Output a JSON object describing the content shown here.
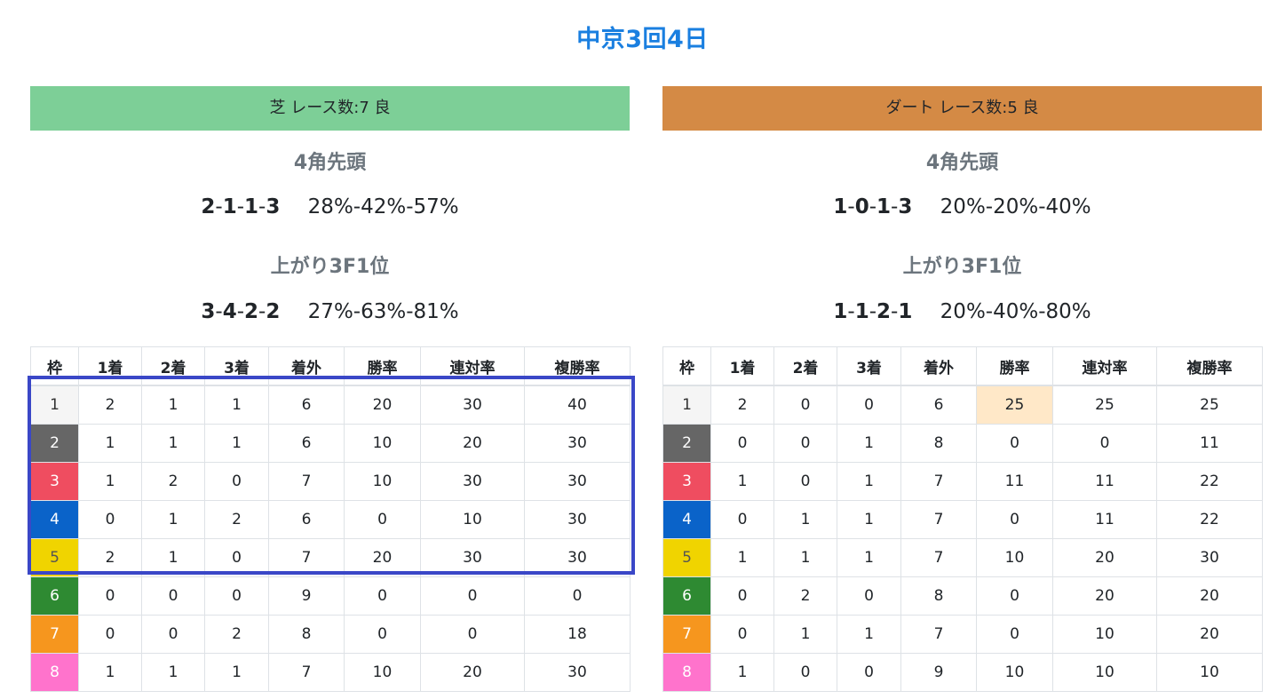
{
  "page_title": "中京3回4日",
  "colors": {
    "turf_header": "#7dcf97",
    "dirt_header": "#d48a45",
    "title": "#1a7fe0",
    "highlight_cell": "#ffe8c8",
    "selection_box": "#3a47c7"
  },
  "columns": [
    "枠",
    "1着",
    "2着",
    "3着",
    "着外",
    "勝率",
    "連対率",
    "複勝率"
  ],
  "turf": {
    "header": "芝 レース数:7 良",
    "corner_title": "4角先頭",
    "corner_counts": [
      "2",
      "1",
      "1",
      "3"
    ],
    "corner_rates": "28%-42%-57%",
    "last3f_title": "上がり3F1位",
    "last3f_counts": [
      "3",
      "4",
      "2",
      "2"
    ],
    "last3f_rates": "27%-63%-81%",
    "rows": [
      [
        "1",
        "2",
        "1",
        "1",
        "6",
        "20",
        "30",
        "40"
      ],
      [
        "2",
        "1",
        "1",
        "1",
        "6",
        "10",
        "20",
        "30"
      ],
      [
        "3",
        "1",
        "2",
        "0",
        "7",
        "10",
        "30",
        "30"
      ],
      [
        "4",
        "0",
        "1",
        "2",
        "6",
        "0",
        "10",
        "30"
      ],
      [
        "5",
        "2",
        "1",
        "0",
        "7",
        "20",
        "30",
        "30"
      ],
      [
        "6",
        "0",
        "0",
        "0",
        "9",
        "0",
        "0",
        "0"
      ],
      [
        "7",
        "0",
        "0",
        "2",
        "8",
        "0",
        "0",
        "18"
      ],
      [
        "8",
        "1",
        "1",
        "1",
        "7",
        "10",
        "20",
        "30"
      ]
    ]
  },
  "dirt": {
    "header": "ダート レース数:5 良",
    "corner_title": "4角先頭",
    "corner_counts": [
      "1",
      "0",
      "1",
      "3"
    ],
    "corner_rates": "20%-20%-40%",
    "last3f_title": "上がり3F1位",
    "last3f_counts": [
      "1",
      "1",
      "2",
      "1"
    ],
    "last3f_rates": "20%-40%-80%",
    "rows": [
      [
        "1",
        "2",
        "0",
        "0",
        "6",
        "25",
        "25",
        "25"
      ],
      [
        "2",
        "0",
        "0",
        "1",
        "8",
        "0",
        "0",
        "11"
      ],
      [
        "3",
        "1",
        "0",
        "1",
        "7",
        "11",
        "11",
        "22"
      ],
      [
        "4",
        "0",
        "1",
        "1",
        "7",
        "0",
        "11",
        "22"
      ],
      [
        "5",
        "1",
        "1",
        "1",
        "7",
        "10",
        "20",
        "30"
      ],
      [
        "6",
        "0",
        "2",
        "0",
        "8",
        "0",
        "20",
        "20"
      ],
      [
        "7",
        "0",
        "1",
        "1",
        "7",
        "0",
        "10",
        "20"
      ],
      [
        "8",
        "1",
        "0",
        "0",
        "9",
        "10",
        "10",
        "10"
      ]
    ]
  }
}
